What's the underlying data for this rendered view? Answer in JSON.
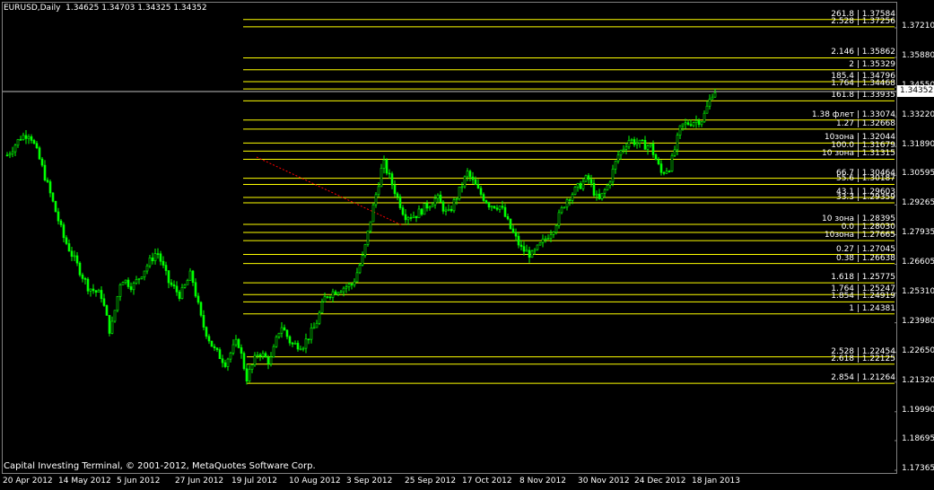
{
  "header": {
    "symbol_text": "EURUSD,Daily  1.34625 1.34703 1.34325 1.34352"
  },
  "footer": {
    "copyright": "Capital Investing Terminal, © 2001-2012, MetaQuotes Software Corp."
  },
  "current_price": "1.34352",
  "colors": {
    "background": "#000000",
    "candles": "#00ff00",
    "levels": "#ffff00",
    "trendline": "#ff0000",
    "text": "#ffffff"
  },
  "y_axis": {
    "labels": [
      "1.37210",
      "1.35880",
      "1.34550",
      "1.33220",
      "1.31890",
      "1.30595",
      "1.29265",
      "1.27935",
      "1.26605",
      "1.25310",
      "1.23980",
      "1.22650",
      "1.21320",
      "1.19990",
      "1.18695",
      "1.17365"
    ]
  },
  "x_axis": {
    "labels": [
      "20 Apr 2012",
      "14 May 2012",
      "5 Jun 2012",
      "27 Jun 2012",
      "19 Jul 2012",
      "10 Aug 2012",
      "3 Sep 2012",
      "25 Sep 2012",
      "17 Oct 2012",
      "8 Nov 2012",
      "30 Nov 2012",
      "24 Dec 2012",
      "18 Jan 2013"
    ]
  },
  "levels": [
    {
      "label": "261.8 | 1.37584",
      "price": 1.37584
    },
    {
      "label": "2.528 | 1.37256",
      "price": 1.37256
    },
    {
      "label": "2.146 | 1.35862",
      "price": 1.35862
    },
    {
      "label": "2 | 1.35329",
      "price": 1.35329
    },
    {
      "label": "185.4 | 1.34796",
      "price": 1.34796
    },
    {
      "label": "1.764 | 1.34468",
      "price": 1.34468
    },
    {
      "label": "161.8 | 1.33935",
      "price": 1.33935
    },
    {
      "label": "1.38 флет | 1.33074",
      "price": 1.33074
    },
    {
      "label": "1.27 | 1.32668",
      "price": 1.32668
    },
    {
      "label": "10зона | 1.32044",
      "price": 1.32044
    },
    {
      "label": "100.0 | 1.31679",
      "price": 1.31679
    },
    {
      "label": "10 зона | 1.31315",
      "price": 1.31315
    },
    {
      "label": "66.7 | 1.30464",
      "price": 1.30464
    },
    {
      "label": "55.6 | 1.30187",
      "price": 1.30187
    },
    {
      "label": "43.1 | 1.29603",
      "price": 1.29603
    },
    {
      "label": "33.3 | 1.29359",
      "price": 1.29359
    },
    {
      "label": "10 зона | 1.28395",
      "price": 1.28395
    },
    {
      "label": "0.0 | 1.28030",
      "price": 1.2803
    },
    {
      "label": "10зона | 1.27665",
      "price": 1.27665
    },
    {
      "label": "0.27 | 1.27045",
      "price": 1.27045
    },
    {
      "label": "0.38 | 1.26638",
      "price": 1.26638
    },
    {
      "label": "1.618 | 1.25775",
      "price": 1.25775
    },
    {
      "label": "1.764 | 1.25247",
      "price": 1.25247
    },
    {
      "label": "1.854 | 1.24919",
      "price": 1.24919
    },
    {
      "label": "1 | 1.24381",
      "price": 1.24381
    },
    {
      "label": "2.528 | 1.22454",
      "price": 1.22454
    },
    {
      "label": "2.618 | 1.22125",
      "price": 1.22125
    },
    {
      "label": "2.854 | 1.21264",
      "price": 1.21264
    }
  ]
}
